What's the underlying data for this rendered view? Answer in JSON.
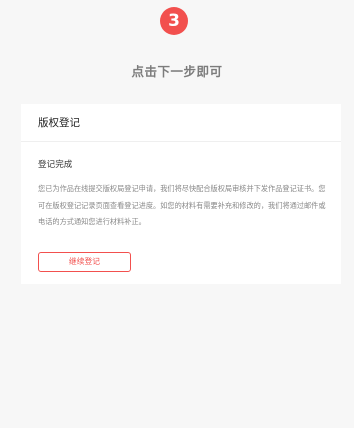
{
  "step": {
    "number": "3",
    "hint": "点击下一步即可"
  },
  "card": {
    "title": "版权登记",
    "status_title": "登记完成",
    "description": "您已为作品在线提交版权局登记申请，我们将尽快配合版权局审核并下发作品登记证书。您可在版权登记记录页面查看登记进度。如您的材料有需要补充和修改的，我们将通过邮件或电话的方式通知您进行材料补正。",
    "continue_label": "继续登记"
  },
  "colors": {
    "accent": "#f2504e",
    "background": "#f7f7f7"
  }
}
